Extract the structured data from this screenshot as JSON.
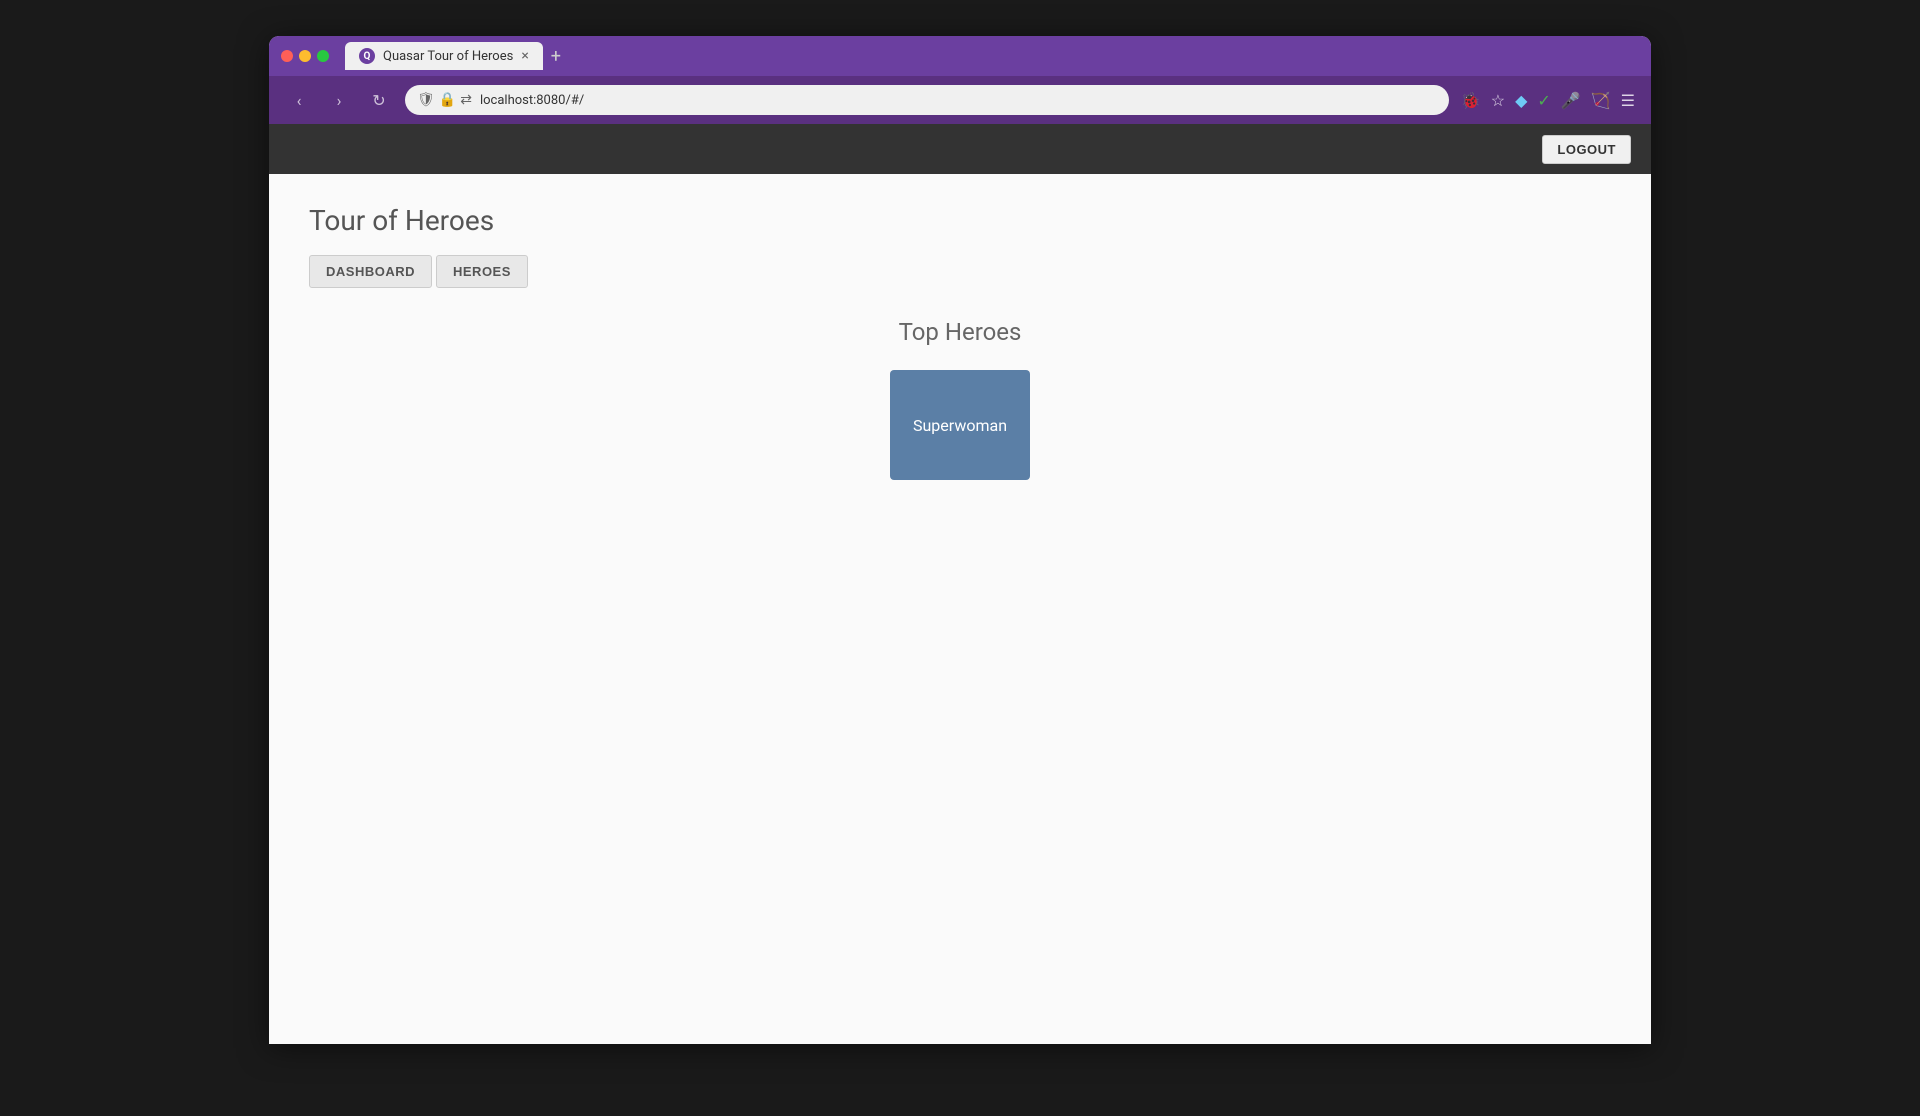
{
  "browser": {
    "tab_title": "Quasar Tour of Heroes",
    "tab_close_icon": "×",
    "tab_new_icon": "+",
    "favicon_text": "Q",
    "address": "localhost:8080/#/",
    "nav_back": "‹",
    "nav_forward": "›",
    "nav_refresh": "↻",
    "toolbar_icons": [
      "🐞",
      "☆",
      "☰"
    ]
  },
  "app": {
    "navbar": {
      "logout_label": "LOGOUT"
    },
    "page": {
      "title": "Tour of Heroes",
      "nav_buttons": [
        {
          "label": "DASHBOARD",
          "id": "dashboard"
        },
        {
          "label": "HEROES",
          "id": "heroes"
        }
      ]
    },
    "dashboard": {
      "section_title": "Top Heroes",
      "heroes": [
        {
          "name": "Superwoman"
        }
      ]
    }
  }
}
